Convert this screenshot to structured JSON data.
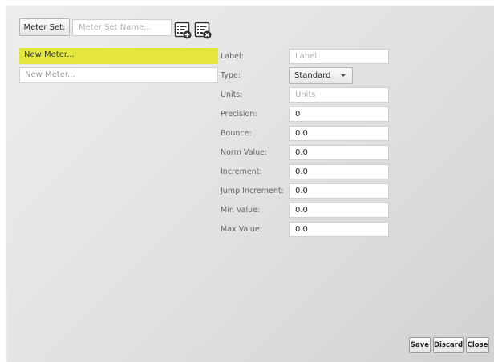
{
  "meter_set": {
    "label": "Meter Set:",
    "name_placeholder": "Meter Set Name...",
    "add_icon": "list-add-icon",
    "remove_icon": "list-remove-icon"
  },
  "meters": {
    "items": [
      {
        "label": "New Meter...",
        "selected": true
      },
      {
        "label": "New Meter...",
        "selected": false
      }
    ],
    "selected_color": "#e4e83c"
  },
  "form": {
    "label": {
      "label": "Label:",
      "placeholder": "Label"
    },
    "type": {
      "label": "Type:",
      "value": "Standard"
    },
    "units": {
      "label": "Units:",
      "placeholder": "Units"
    },
    "precision": {
      "label": "Precision:",
      "value": "0"
    },
    "bounce": {
      "label": "Bounce:",
      "value": "0.0"
    },
    "norm_value": {
      "label": "Norm Value:",
      "value": "0.0"
    },
    "increment": {
      "label": "Increment:",
      "value": "0.0"
    },
    "jump_increment": {
      "label": "Jump Increment:",
      "value": "0.0"
    },
    "min_value": {
      "label": "Min Value:",
      "value": "0.0"
    },
    "max_value": {
      "label": "Max Value:",
      "value": "0.0"
    }
  },
  "actions": {
    "save": "Save",
    "discard": "Discard",
    "close": "Close"
  }
}
